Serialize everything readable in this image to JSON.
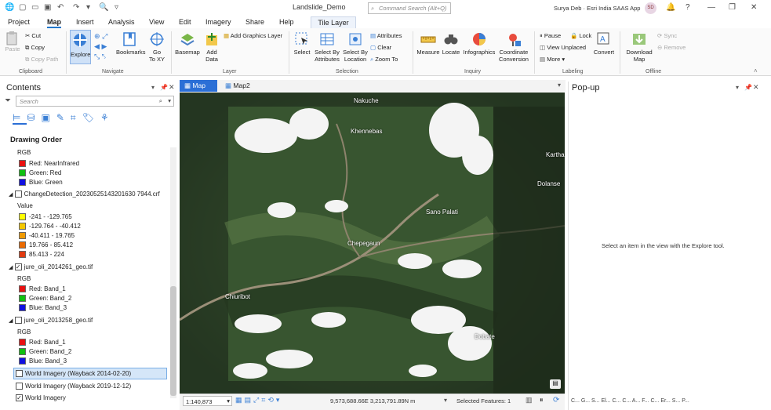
{
  "titlebar": {
    "doc_title": "Landslide_Demo",
    "search_placeholder": "Command Search (Alt+Q)",
    "user_name": "Surya Deb  ·  Esri India SAAS App",
    "avatar": "SD"
  },
  "menu": [
    "Project",
    "Map",
    "Insert",
    "Analysis",
    "View",
    "Edit",
    "Imagery",
    "Share",
    "Help"
  ],
  "contextual_tab": "Tile Layer",
  "ribbon": {
    "clipboard": {
      "paste": "Paste",
      "cut": "Cut",
      "copy": "Copy",
      "copy_path": "Copy Path",
      "group": "Clipboard"
    },
    "navigate": {
      "explore": "Explore",
      "bookmarks": "Bookmarks",
      "go_to_xy": "Go\nTo XY",
      "group": "Navigate"
    },
    "layer": {
      "basemap": "Basemap",
      "add_data": "Add\nData",
      "add_graphics": "Add Graphics Layer",
      "group": "Layer"
    },
    "selection": {
      "select": "Select",
      "select_by_attributes": "Select By\nAttributes",
      "select_by_location": "Select By\nLocation",
      "attributes": "Attributes",
      "clear": "Clear",
      "zoom_to": "Zoom To",
      "group": "Selection"
    },
    "inquiry": {
      "measure": "Measure",
      "locate": "Locate",
      "infographics": "Infographics",
      "coordinate_conversion": "Coordinate\nConversion",
      "group": "Inquiry"
    },
    "labeling": {
      "pause": "Pause",
      "lock": "Lock",
      "view_unplaced": "View Unplaced",
      "more": "More",
      "convert": "Convert",
      "group": "Labeling"
    },
    "offline": {
      "download_map": "Download\nMap",
      "sync": "Sync",
      "remove": "Remove",
      "group": "Offline"
    }
  },
  "contents": {
    "title": "Contents",
    "search_placeholder": "Search",
    "drawing_order": "Drawing Order",
    "layers": [
      {
        "name": "",
        "checked": true,
        "legend_title": "RGB",
        "items": [
          {
            "label": "Red:   NearInfrared",
            "color": "#e81010"
          },
          {
            "label": "Green: Red",
            "color": "#10c010"
          },
          {
            "label": "Blue:  Green",
            "color": "#1010e0"
          }
        ]
      },
      {
        "name": "ChangeDetection_20230525143201630 7944.crf",
        "checked": false,
        "legend_title": "Value",
        "items": [
          {
            "label": "-241 - -129.765",
            "color": "#ffff00"
          },
          {
            "label": "-129.764 - -40.412",
            "color": "#f5c800"
          },
          {
            "label": "-40.411 - 19.765",
            "color": "#f09a00"
          },
          {
            "label": "19.766 - 85.412",
            "color": "#ea6a00"
          },
          {
            "label": "85.413 - 224",
            "color": "#e03a10"
          }
        ]
      },
      {
        "name": "jure_oli_2014261_geo.tif",
        "checked": true,
        "legend_title": "RGB",
        "items": [
          {
            "label": "Red:   Band_1",
            "color": "#e81010"
          },
          {
            "label": "Green: Band_2",
            "color": "#10c010"
          },
          {
            "label": "Blue:  Band_3",
            "color": "#1010e0"
          }
        ]
      },
      {
        "name": "jure_oli_2013258_geo.tif",
        "checked": false,
        "legend_title": "RGB",
        "items": [
          {
            "label": "Red:   Band_1",
            "color": "#e81010"
          },
          {
            "label": "Green: Band_2",
            "color": "#10c010"
          },
          {
            "label": "Blue:  Band_3",
            "color": "#1010e0"
          }
        ]
      }
    ],
    "basemaps": [
      {
        "name": "World Imagery (Wayback 2014-02-20)",
        "checked": false,
        "selected": true
      },
      {
        "name": "World Imagery (Wayback 2019-12-12)",
        "checked": false,
        "selected": false
      },
      {
        "name": "World Imagery",
        "checked": true,
        "selected": false
      }
    ]
  },
  "map_tabs": [
    "Map",
    "Map2"
  ],
  "places": [
    "Nakuche",
    "Khennebas",
    "Sano Palati",
    "Chepegaun",
    "Chiuribot",
    "Dobate",
    "Dolanse",
    "Kartha"
  ],
  "status": {
    "scale": "1:140,873",
    "coords": "9,573,688.66E 3,213,791.89N m",
    "selected_features": "Selected Features: 1"
  },
  "popup": {
    "title": "Pop-up",
    "message": "Select an item in the view with the Explore tool.",
    "tabs": "C...  G...  S...  El...  C...  C...  A...  F...  C...  Er...  S...  P..."
  }
}
